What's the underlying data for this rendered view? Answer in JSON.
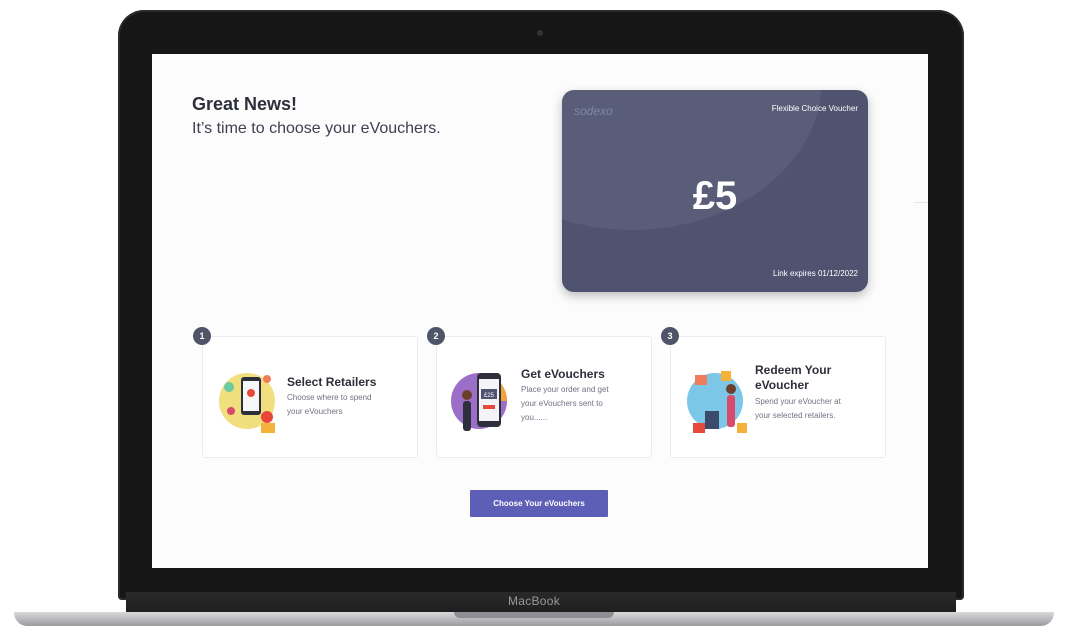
{
  "device": {
    "brand_label": "MacBook"
  },
  "hero": {
    "headline": "Great News!",
    "subline": "It’s time to choose your eVouchers."
  },
  "voucher": {
    "brand": "sodexo",
    "type": "Flexible Choice Voucher",
    "amount": "£5",
    "expiry": "Link expires 01/12/2022",
    "colors": {
      "card": "#4f5370",
      "text": "#ffffff"
    }
  },
  "steps": [
    {
      "number": "1",
      "title": "Select Retailers",
      "desc_lines": [
        "Choose where to spend",
        "your eVouchers"
      ]
    },
    {
      "number": "2",
      "title": "Get eVouchers",
      "desc_lines": [
        "Place your order and get",
        "your eVouchers sent to",
        "you......"
      ],
      "phone_label": "£25"
    },
    {
      "number": "3",
      "title_lines": [
        "Redeem Your",
        "eVoucher"
      ],
      "desc_lines": [
        "Spend your eVoucher at",
        "your selected retailers."
      ]
    }
  ],
  "cta": {
    "label": "Choose Your eVouchers",
    "color": "#5c5fb5"
  }
}
